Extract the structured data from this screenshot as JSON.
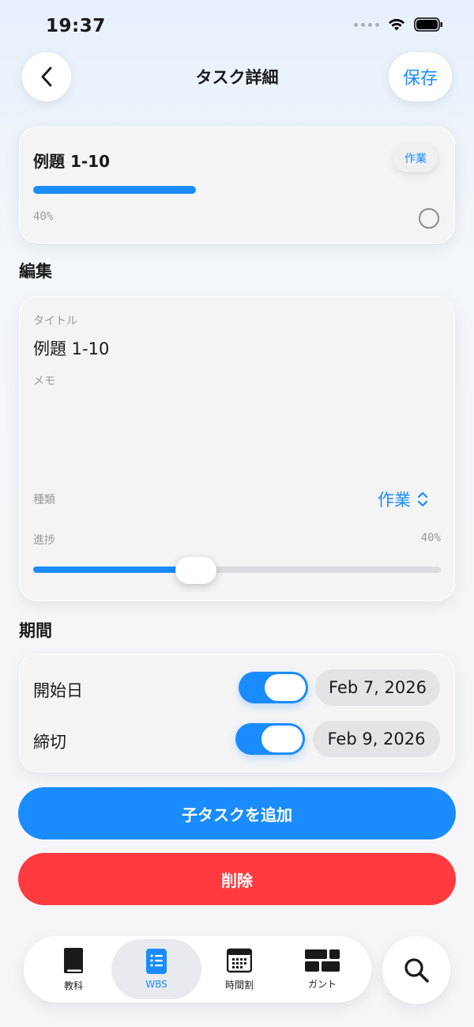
{
  "status_bar": {
    "time": "19:37"
  },
  "header": {
    "title": "タスク詳細",
    "save_label": "保存"
  },
  "summary": {
    "title": "例題 1-10",
    "kind_chip": "作業",
    "progress_percent": 40,
    "progress_label": "40%"
  },
  "edit": {
    "section_title": "編集",
    "title_label": "タイトル",
    "title_value": "例題 1-10",
    "memo_label": "メモ",
    "memo_value": "",
    "kind_label": "種類",
    "kind_value": "作業",
    "progress_label": "進捗",
    "progress_value_label": "40%",
    "progress_value": 40
  },
  "period": {
    "section_title": "期間",
    "start_label": "開始日",
    "start_enabled": true,
    "start_date": "Feb 7, 2026",
    "due_label": "締切",
    "due_enabled": true,
    "due_date": "Feb 9, 2026"
  },
  "actions": {
    "add_child_label": "子タスクを追加",
    "delete_label": "削除"
  },
  "tabbar": {
    "tabs": [
      {
        "label": "教科",
        "icon": "book-icon",
        "active": false
      },
      {
        "label": "WBS",
        "icon": "list-icon",
        "active": true
      },
      {
        "label": "時間割",
        "icon": "calendar-icon",
        "active": false
      },
      {
        "label": "ガント",
        "icon": "gantt-icon",
        "active": false
      }
    ],
    "search_icon": "search-icon"
  },
  "colors": {
    "accent": "#1a8cff",
    "danger": "#ff3b3f"
  }
}
